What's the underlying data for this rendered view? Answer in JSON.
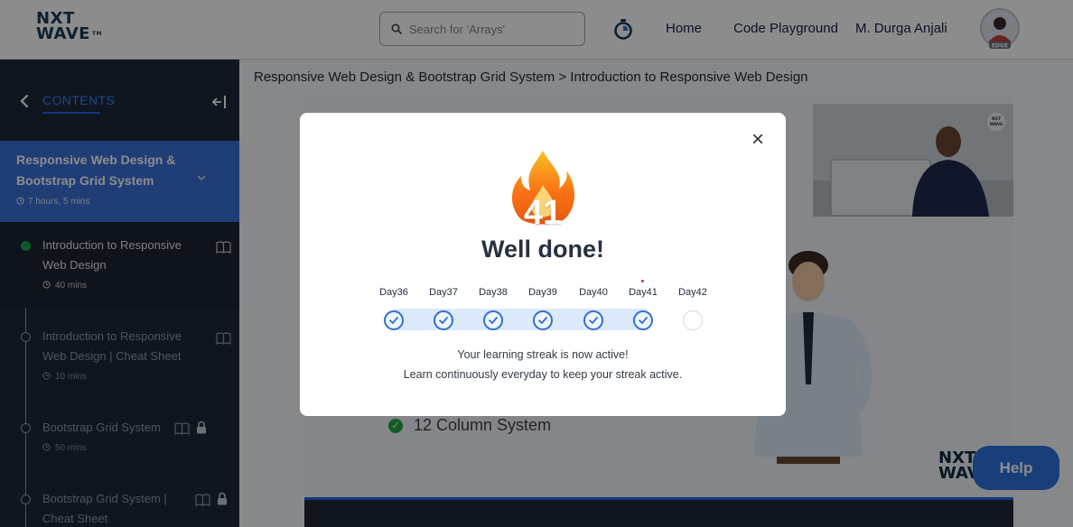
{
  "header": {
    "logo_line1": "NXT",
    "logo_line2": "WAVE",
    "logo_tm": "TM",
    "search_placeholder": "Search for 'Arrays'",
    "nav": [
      "Home",
      "Code Playground",
      "M. Durga Anjali"
    ],
    "avatar_badge": "EDGE"
  },
  "sidebar": {
    "contents_label": "CONTENTS",
    "course_title": "Responsive Web Design & Bootstrap Grid System",
    "course_duration": "7 hours, 5 mins",
    "items": [
      {
        "title": "Introduction to Responsive Web Design",
        "duration": "40 mins",
        "status": "completed",
        "locked": false
      },
      {
        "title": "Introduction to Responsive Web Design | Cheat Sheet",
        "duration": "10 mins",
        "status": "pending",
        "locked": false
      },
      {
        "title": "Bootstrap Grid System",
        "duration": "50 mins",
        "status": "pending",
        "locked": true
      },
      {
        "title": "Bootstrap Grid System | Cheat Sheet",
        "duration": "",
        "status": "pending",
        "locked": true
      }
    ]
  },
  "main": {
    "breadcrumb": "Responsive Web Design & Bootstrap Grid System > Introduction to Responsive Web Design",
    "slide_bullet": "12 Column System",
    "slide_logo_line1": "NXT",
    "slide_logo_line2": "WAVE",
    "help_label": "Help",
    "video_logo_line1": "NXT",
    "video_logo_line2": "WAVE"
  },
  "modal": {
    "streak_count": "41",
    "title": "Well done!",
    "days": [
      {
        "label": "Day36",
        "completed": true
      },
      {
        "label": "Day37",
        "completed": true
      },
      {
        "label": "Day38",
        "completed": true
      },
      {
        "label": "Day39",
        "completed": true
      },
      {
        "label": "Day40",
        "completed": true
      },
      {
        "label": "Day41",
        "completed": true
      },
      {
        "label": "Day42",
        "completed": false
      }
    ],
    "message_line1": "Your learning streak is now active!",
    "message_line2": "Learn continuously everyday to keep your streak active.",
    "close_symbol": "×"
  },
  "colors": {
    "sidebar_bg": "#1e293b",
    "course_highlight": "#3b6fd8",
    "accent_blue": "#2f6fd3",
    "help_button": "#2f74e0",
    "flame_orange": "#f97316",
    "completed_green": "#16a34a"
  },
  "icons": [
    "search-icon",
    "timer-icon",
    "back-chevron-icon",
    "collapse-icon",
    "chevron-down-icon",
    "clock-icon",
    "book-icon",
    "lock-icon",
    "check-icon",
    "close-icon",
    "flame-icon"
  ]
}
